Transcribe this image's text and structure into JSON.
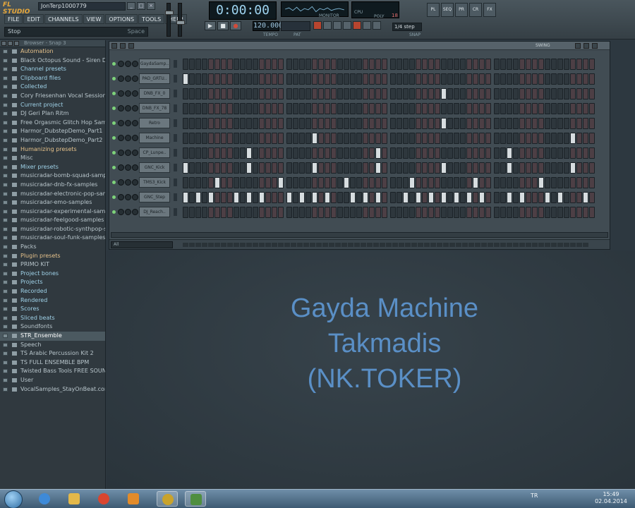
{
  "window": {
    "logo": "FL STUDIO",
    "title": "JonTerp1000779"
  },
  "menu": [
    "FILE",
    "EDIT",
    "CHANNELS",
    "VIEW",
    "OPTIONS",
    "TOOLS",
    "HELP"
  ],
  "hint": {
    "text": "Stop",
    "right": "Space"
  },
  "transport": {
    "time": "0:00:00",
    "tempo": "120.000",
    "tempo_label": "TEMPO",
    "pat_label": "PAT",
    "snap_value": "1/4 step",
    "snap_label": "SNAP",
    "monitor_label": "MONITOR",
    "cpu_label": "CPU",
    "poly_label": "POLY",
    "poly_value": "18"
  },
  "right_buttons": [
    "PL",
    "SEQ",
    "PR",
    "CR",
    "FX"
  ],
  "browser": {
    "title": "Browser - Snap 3",
    "items": [
      {
        "label": "Automation",
        "style": "hl"
      },
      {
        "label": "Black Octopus Sound - Siren Dubstep",
        "style": ""
      },
      {
        "label": "Channel presets",
        "style": "hl2"
      },
      {
        "label": "Clipboard files",
        "style": "hl2"
      },
      {
        "label": "Collected",
        "style": "hl2"
      },
      {
        "label": "Cory Friesenhan Vocal Sessions",
        "style": ""
      },
      {
        "label": "Current project",
        "style": "hl2"
      },
      {
        "label": "DJ Geri Plan Ritm",
        "style": ""
      },
      {
        "label": "Free Orgasmic Glitch Hop Samples",
        "style": ""
      },
      {
        "label": "Harmor_DubstepDemo_Part1",
        "style": ""
      },
      {
        "label": "Harmor_DubstepDemo_Part2",
        "style": ""
      },
      {
        "label": "Humanizing presets",
        "style": "hl"
      },
      {
        "label": "Misc",
        "style": ""
      },
      {
        "label": "Mixer presets",
        "style": "hl2"
      },
      {
        "label": "musicradar-bomb-squad-samples",
        "style": ""
      },
      {
        "label": "musicradar-dnb-fx-samples",
        "style": ""
      },
      {
        "label": "musicradar-electronic-pop-samples",
        "style": ""
      },
      {
        "label": "musicradar-emo-samples",
        "style": ""
      },
      {
        "label": "musicradar-experimental-samples",
        "style": ""
      },
      {
        "label": "musicradar-feelgood-samples",
        "style": ""
      },
      {
        "label": "musicradar-robotic-synthpop-samples",
        "style": ""
      },
      {
        "label": "musicradar-soul-funk-samples",
        "style": ""
      },
      {
        "label": "Packs",
        "style": ""
      },
      {
        "label": "Plugin presets",
        "style": "hl"
      },
      {
        "label": "PRIMO KIT",
        "style": ""
      },
      {
        "label": "Project bones",
        "style": "hl2"
      },
      {
        "label": "Projects",
        "style": "hl2"
      },
      {
        "label": "Recorded",
        "style": "hl2"
      },
      {
        "label": "Rendered",
        "style": "hl2"
      },
      {
        "label": "Scores",
        "style": "hl2"
      },
      {
        "label": "Sliced beats",
        "style": "hl2"
      },
      {
        "label": "Soundfonts",
        "style": ""
      },
      {
        "label": "STR_Ensemble",
        "style": "sel"
      },
      {
        "label": "Speech",
        "style": ""
      },
      {
        "label": "TS Arabic Percussion Kit 2",
        "style": ""
      },
      {
        "label": "TS FULL ENSEMBLE BPM",
        "style": ""
      },
      {
        "label": "Twisted Bass Tools FREE SOUNDS",
        "style": ""
      },
      {
        "label": "User",
        "style": ""
      },
      {
        "label": "VocalSamples_StayOnBeat.com",
        "style": ""
      }
    ]
  },
  "sequencer": {
    "swing_label": "SWING",
    "filter_label": "All",
    "channels": [
      {
        "name": "GaydaSamp..",
        "on": []
      },
      {
        "name": "PAD_GRTU..",
        "on": [
          0
        ]
      },
      {
        "name": "DNB_FX_0",
        "on": [
          40
        ]
      },
      {
        "name": "DNB_FX_78",
        "on": []
      },
      {
        "name": "Retro",
        "on": [
          40
        ]
      },
      {
        "name": "Machine",
        "on": [
          20,
          60
        ]
      },
      {
        "name": "CP_Lunpe..",
        "on": [
          10,
          30,
          50,
          70
        ]
      },
      {
        "name": "GNC_Kick",
        "on": [
          0,
          10,
          20,
          30,
          40,
          50,
          60,
          70
        ]
      },
      {
        "name": "TMS3_Kick",
        "on": [
          5,
          15,
          25,
          35,
          45,
          55,
          65,
          75
        ]
      },
      {
        "name": "GNC_Step",
        "on": [
          0,
          2,
          4,
          8,
          10,
          12,
          16,
          18,
          20,
          22,
          26,
          28,
          30,
          34,
          36,
          38,
          40,
          42,
          44,
          46,
          50,
          52,
          56,
          58,
          62,
          64,
          66,
          68,
          72,
          74
        ]
      },
      {
        "name": "DJ_Reach..",
        "on": [
          70
        ]
      }
    ]
  },
  "overlay": {
    "line1": "Gayda Machine",
    "line2": "Takmadis",
    "line3": "(NK.TOKER)"
  },
  "taskbar": {
    "tray_lang": "TR",
    "time": "15:49",
    "date": "02.04.2014"
  }
}
